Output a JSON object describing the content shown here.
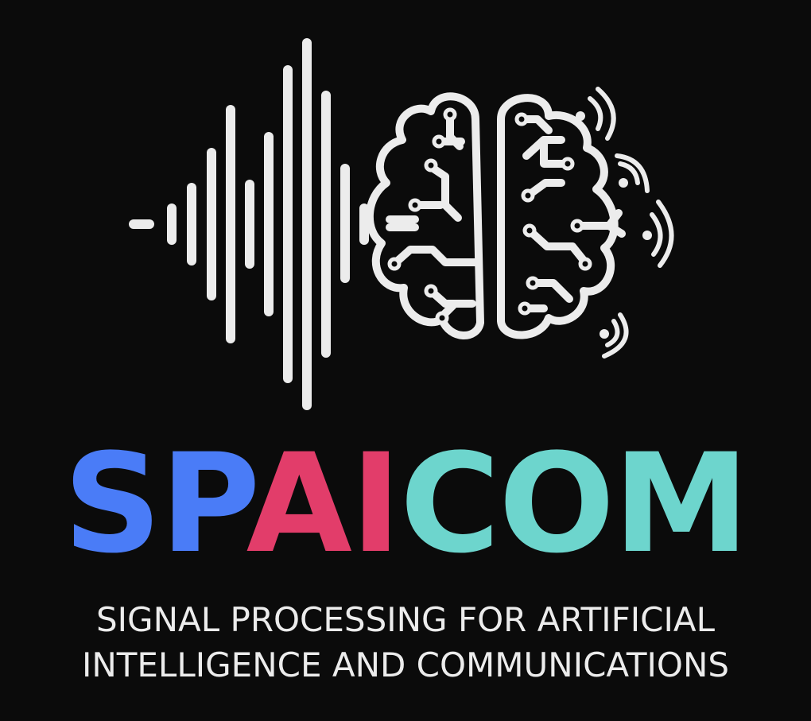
{
  "logo": {
    "icon": "sound-wave-brain-circuit-icon",
    "wordmark": {
      "part_sp": "SP",
      "part_ai": "AI",
      "part_com": "COM"
    },
    "tagline": {
      "line1": "SIGNAL PROCESSING FOR ARTIFICIAL",
      "line2": "INTELLIGENCE AND COMMUNICATIONS"
    }
  },
  "colors": {
    "background": "#0b0b0b",
    "icon": "#ececec",
    "sp": "#4a7cf7",
    "ai": "#e23d6a",
    "com": "#6dd5cd",
    "tagline": "#ececec"
  }
}
